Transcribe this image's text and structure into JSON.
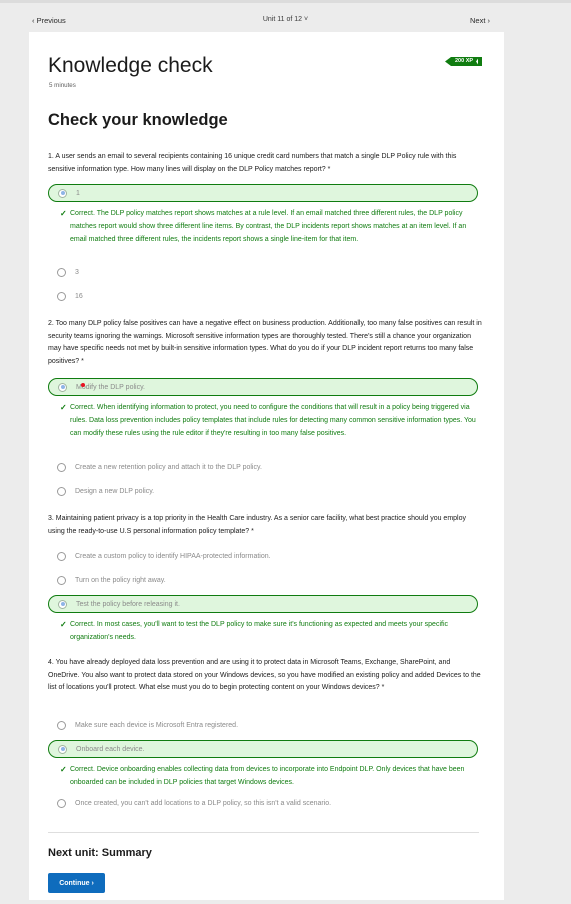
{
  "nav": {
    "previous": "Previous",
    "unit": "Unit 11 of 12",
    "next": "Next"
  },
  "header": {
    "title": "Knowledge check",
    "minutes": "5 minutes",
    "xp": "200 XP"
  },
  "section_title": "Check your knowledge",
  "questions": [
    {
      "text": "1. A user sends an email to several recipients containing 16 unique credit card numbers that match a single DLP Policy rule with this sensitive information type. How many lines will display on the DLP Policy matches report? *",
      "options": [
        "1",
        "3",
        "16"
      ],
      "selected": 0,
      "feedback": "Correct. The DLP policy matches report shows matches at a rule level. If an email matched three different rules, the DLP policy matches report would show three different line items. By contrast, the DLP incidents report shows matches at an item level. If an email matched three different rules, the incidents report shows a single line-item for that item."
    },
    {
      "text": "2. Too many DLP policy false positives can have a negative effect on business production. Additionally, too many false positives can result in security teams ignoring the warnings. Microsoft sensitive information types are thoroughly tested. There's still a chance your organization may have specific needs not met by built-in sensitive information types. What do you do if your DLP incident report returns too many false positives? *",
      "options": [
        "Modify the DLP policy.",
        "Create a new retention policy and attach it to the DLP policy.",
        "Design a new DLP policy."
      ],
      "selected": 0,
      "feedback": "Correct. When identifying information to protect, you need to configure the conditions that will result in a policy being triggered via rules. Data loss prevention includes policy templates that include rules for detecting many common sensitive information types. You can modify these rules using the rule editor if they're resulting in too many false positives."
    },
    {
      "text": "3. Maintaining patient privacy is a top priority in the Health Care industry. As a senior care facility, what best practice should you employ using the ready-to-use U.S personal information policy template? *",
      "options": [
        "Create a custom policy to identify HIPAA-protected information.",
        "Turn on the policy right away.",
        "Test the policy before releasing it."
      ],
      "selected": 2,
      "feedback": "Correct. In most cases, you'll want to test the DLP policy to make sure it's functioning as expected and meets your specific organization's needs."
    },
    {
      "text": "4. You have already deployed data loss prevention and are using it to protect data in Microsoft Teams, Exchange, SharePoint, and OneDrive. You also want to protect data stored on your Windows devices, so you have modified an existing policy and added Devices to the list of locations you'll protect. What else must you do to begin protecting content on your Windows devices? *",
      "options": [
        "Make sure each device is Microsoft Entra registered.",
        "Onboard each device.",
        "Once created, you can't add locations to a DLP policy, so this isn't a valid scenario."
      ],
      "selected": 1,
      "feedback": "Correct. Device onboarding enables collecting data from devices to incorporate into Endpoint DLP. Only devices that have been onboarded can be included in DLP policies that target Windows devices."
    }
  ],
  "footer": {
    "next_unit": "Next unit: Summary",
    "continue": "Continue"
  },
  "colors": {
    "correct_green": "#107c10",
    "selected_bg": "#dff6dd",
    "primary_blue": "#0f6cbd"
  }
}
